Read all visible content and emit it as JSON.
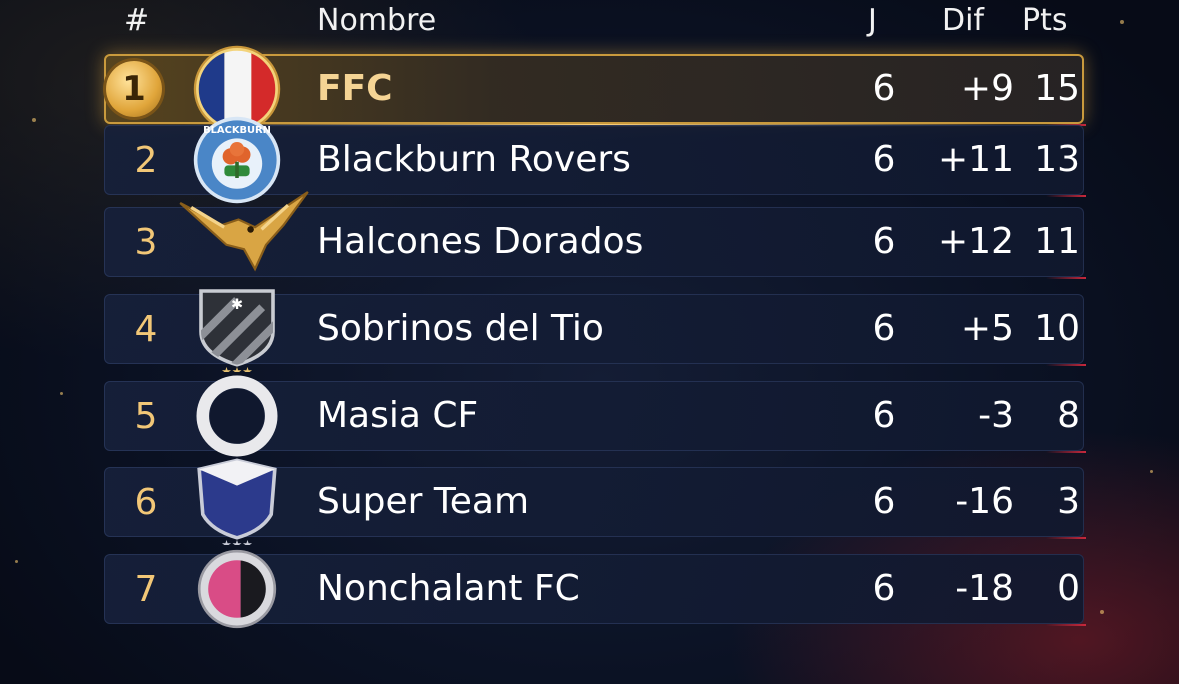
{
  "header": {
    "rank": "#",
    "name": "Nombre",
    "played": "J",
    "diff": "Dif",
    "points": "Pts"
  },
  "colors": {
    "gold": "#f2c777",
    "accent_red": "#c8283c",
    "background": "#0b1224"
  },
  "rows": [
    {
      "rank": "1",
      "name": "FFC",
      "played": "6",
      "diff": "+9",
      "points": "15",
      "badge": "france-flag-badge"
    },
    {
      "rank": "2",
      "name": "Blackburn Rovers",
      "played": "6",
      "diff": "+11",
      "points": "13",
      "badge": "blackburn-rovers-crest",
      "badge_text": "BLACKBURN"
    },
    {
      "rank": "3",
      "name": "Halcones Dorados",
      "played": "6",
      "diff": "+12",
      "points": "11",
      "badge": "golden-falcon-crest"
    },
    {
      "rank": "4",
      "name": "Sobrinos del Tio",
      "played": "6",
      "diff": "+5",
      "points": "10",
      "badge": "striped-shield-crest"
    },
    {
      "rank": "5",
      "name": "Masia CF",
      "played": "6",
      "diff": "-3",
      "points": "8",
      "badge": "white-ring-crest"
    },
    {
      "rank": "6",
      "name": "Super Team",
      "played": "6",
      "diff": "-16",
      "points": "3",
      "badge": "blue-shield-crest"
    },
    {
      "rank": "7",
      "name": "Nonchalant FC",
      "played": "6",
      "diff": "-18",
      "points": "0",
      "badge": "pink-black-circle-crest"
    }
  ]
}
